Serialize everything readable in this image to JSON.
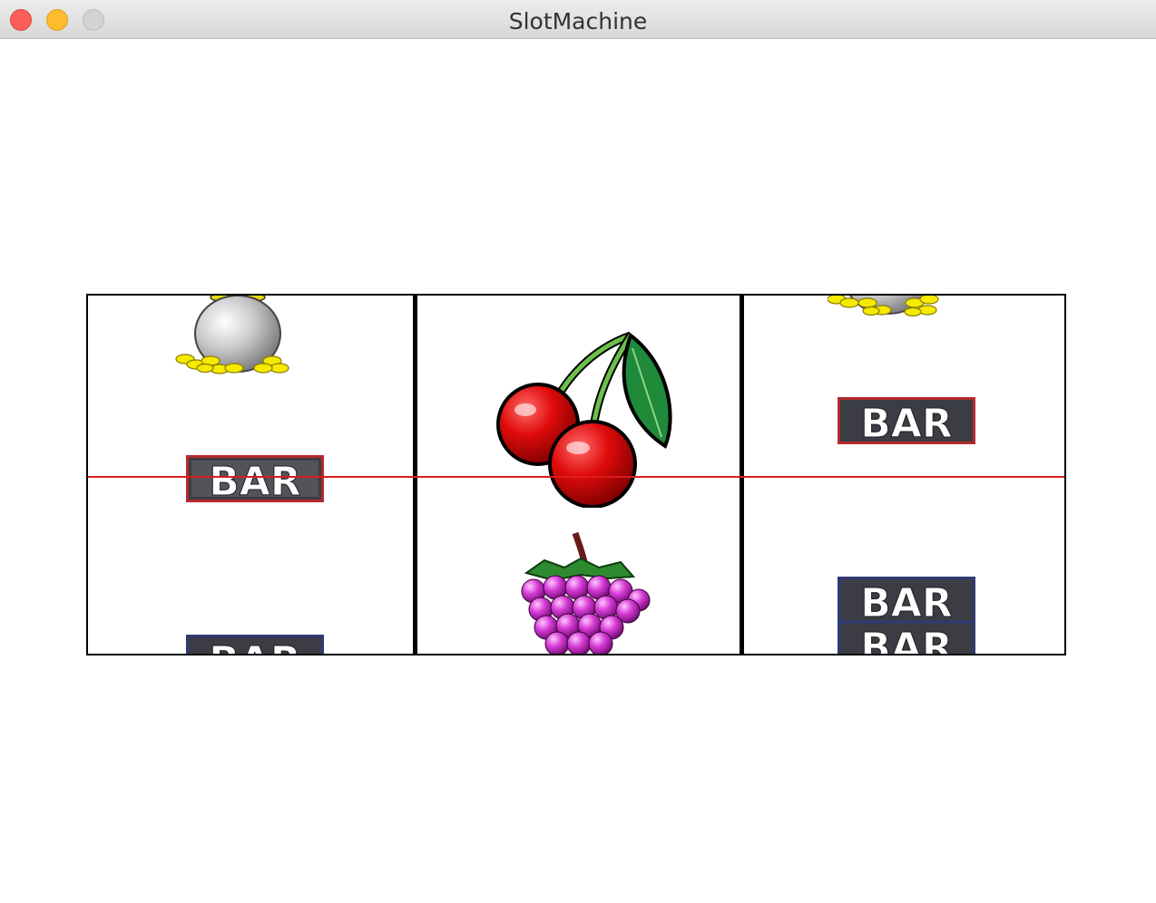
{
  "window": {
    "title": "SlotMachine"
  },
  "reels": [
    {
      "symbols": [
        "pot-of-gold",
        "bar",
        "bar"
      ],
      "bar_text": "BAR"
    },
    {
      "symbols": [
        "cherries",
        "grapes"
      ]
    },
    {
      "symbols": [
        "pot-of-gold",
        "bar",
        "double-bar"
      ],
      "bar_text": "BAR"
    }
  ],
  "colors": {
    "payline": "#d91d1d",
    "single_bar_border": "#b32a2e",
    "double_bar_border": "#2f3a78"
  }
}
